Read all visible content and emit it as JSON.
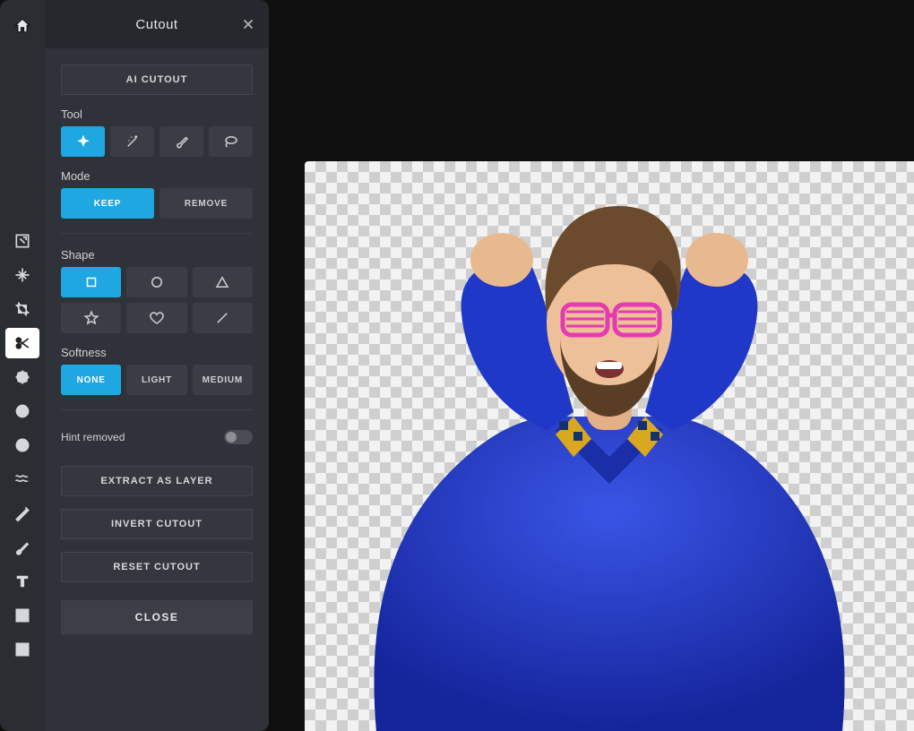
{
  "panel": {
    "title": "Cutout",
    "ai_cutout": "AI CUTOUT",
    "tool_label": "Tool",
    "mode_label": "Mode",
    "mode_keep": "KEEP",
    "mode_remove": "REMOVE",
    "shape_label": "Shape",
    "softness_label": "Softness",
    "softness_none": "NONE",
    "softness_light": "LIGHT",
    "softness_medium": "MEDIUM",
    "hint_removed": "Hint removed",
    "extract": "EXTRACT AS LAYER",
    "invert": "INVERT CUTOUT",
    "reset": "RESET CUTOUT",
    "close": "CLOSE"
  },
  "rail_icons": [
    "open-image-icon",
    "arrange-icon",
    "crop-icon",
    "cutout-icon",
    "adjust-icon",
    "filter-icon",
    "effect-icon",
    "liquify-icon",
    "retouch-icon",
    "draw-icon",
    "text-icon",
    "element-icon",
    "frame-icon"
  ],
  "colors": {
    "accent": "#1ea7e1"
  }
}
